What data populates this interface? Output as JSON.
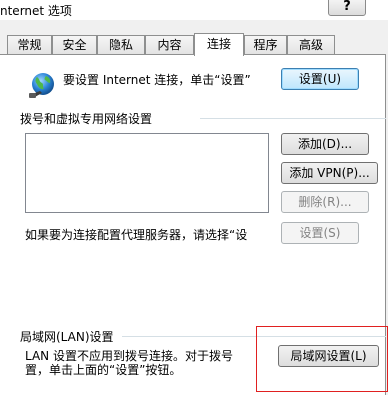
{
  "window": {
    "title": "nternet 选项",
    "help_label": "?"
  },
  "tabs": [
    {
      "label": "常规",
      "active": false
    },
    {
      "label": "安全",
      "active": false
    },
    {
      "label": "隐私",
      "active": false
    },
    {
      "label": "内容",
      "active": false
    },
    {
      "label": "连接",
      "active": true
    },
    {
      "label": "程序",
      "active": false
    },
    {
      "label": "高级",
      "active": false
    }
  ],
  "connection": {
    "setup_text": "要设置 Internet 连接，单击“设置”",
    "setup_button": "设置(U)",
    "dialup_section_label": "拨号和虚拟专用网络设置",
    "add_button": "添加(D)...",
    "add_vpn_button": "添加 VPN(P)...",
    "remove_button": "删除(R)...",
    "proxy_text": "如果要为连接配置代理服务器，请选择“设",
    "settings_button": "设置(S)"
  },
  "lan": {
    "section_label": "局域网(LAN)设置",
    "description_line1": "LAN 设置不应用到拨号连接。对于拨号",
    "description_line2": "置，单击上面的“设置”按钮。",
    "lan_settings_button": "局域网设置(L)"
  },
  "colors": {
    "highlight_border": "#e02020",
    "primary_button_border": "#3c7fb1"
  }
}
